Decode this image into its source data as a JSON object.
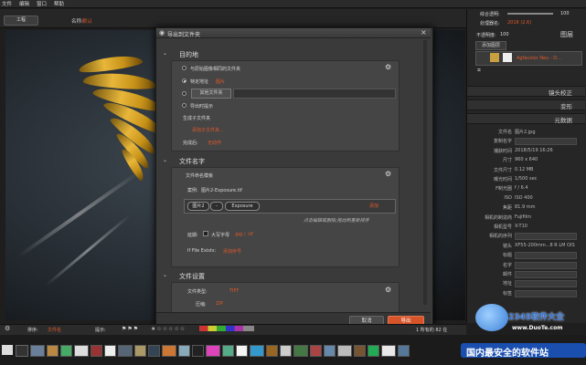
{
  "menu": [
    "文件",
    "编辑",
    "窗口",
    "帮助"
  ],
  "toolbar": {
    "button": "工程",
    "sort_label": "名称:",
    "sort_value": "默认"
  },
  "right_panel": {
    "opacity_label": "综合透明:",
    "opacity_value": "100",
    "blend_label": "处理器名:",
    "blend_value": "2018 (2.6)",
    "transparency_label": "不透明度:",
    "transparency_value": "100",
    "layers_title": "图层",
    "add_layer": "添加图层",
    "layer_name": "Agfacolor Neu - D...",
    "lens_title": "镜头校正",
    "transform_title": "变形",
    "metadata_title": "元数据",
    "meta_rows": [
      {
        "label": "文件名",
        "value": "图片2.jpg"
      },
      {
        "label": "复制名字",
        "value": ""
      },
      {
        "label": "捕获时间",
        "value": "2018/5/19 16:26"
      },
      {
        "label": "尺寸",
        "value": "960 x 640"
      },
      {
        "label": "文件尺寸",
        "value": "0.12 MB"
      },
      {
        "label": "曝光时间",
        "value": "1/500 sec"
      },
      {
        "label": "F制光圈",
        "value": "f / 6.4"
      },
      {
        "label": "ISO",
        "value": "ISO 400"
      },
      {
        "label": "焦距",
        "value": "81.9 mm"
      },
      {
        "label": "相机的制造商",
        "value": "Fujifilm"
      },
      {
        "label": "相机型号",
        "value": "X-T10"
      },
      {
        "label": "相机的序列",
        "value": ""
      },
      {
        "label": "镜头",
        "value": "XF55-200mm...8 R LM OIS"
      },
      {
        "label": "标题",
        "value": ""
      },
      {
        "label": "名字",
        "value": ""
      },
      {
        "label": "邮件",
        "value": ""
      },
      {
        "label": "地址",
        "value": ""
      },
      {
        "label": "标签",
        "value": ""
      }
    ]
  },
  "dialog": {
    "title": "导出到文件夹",
    "section1": "目的地",
    "opt_same": "与原始图像相同的文件夹",
    "opt_desktop": "特定地址",
    "opt_desktop_val": "图片",
    "opt_other_btn": "其他文件夹",
    "opt_ask": "导出时提示",
    "subfolder_label": "生成子文件夹",
    "subfolder_link": "添加子文件夹...",
    "after_label": "完成后:",
    "after_value": "无动作",
    "section2": "文件名字",
    "template_label": "文件命名模板",
    "sample_label": "案例:",
    "sample_value": "图片2-Exposure.tif",
    "token1": "图片2",
    "token2": "-",
    "token3": "Exposure",
    "add_btn": "添加",
    "hint": "点击编辑或删除;拖动到重新排序",
    "ext_label": "延期:",
    "uppercase_label": "大写字母",
    "ext_value": ".jpg / .tif",
    "exists_label": "If File Exists:",
    "exists_value": "添加序号",
    "section3": "文件设置",
    "type_label": "文件类型:",
    "type_value": "TIFF",
    "compress_label": "压缩:",
    "compress_value": "ZIP",
    "cancel": "取消",
    "export": "导出"
  },
  "bottom": {
    "sort_label": "排序:",
    "sort_value": "文件名",
    "filter_label": "提示:",
    "count": "1 所有的 82 在"
  },
  "watermark": {
    "top": "2345软件大全",
    "url": "www.DuoTe.com",
    "bottom": "国内最安全的软件站"
  },
  "colors": {
    "accent": "#e0592a",
    "dialog_bg": "#3a3a3a",
    "section_bg": "#454545"
  }
}
